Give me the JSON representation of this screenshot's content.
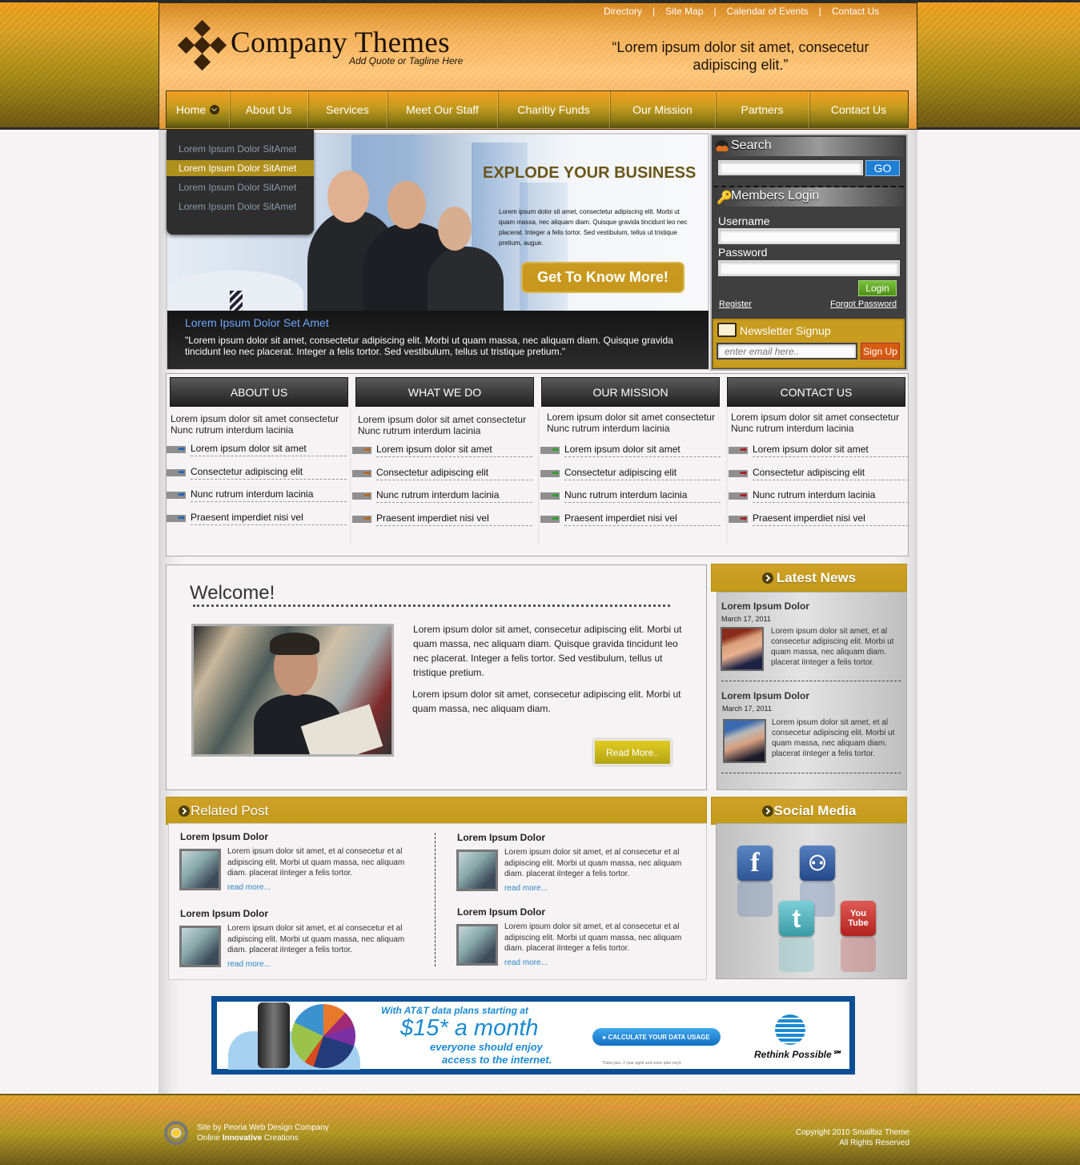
{
  "header": {
    "logo_text": "Company Themes",
    "tagline": "Add Quote or Tagline Here",
    "quote": "“Lorem ipsum dolor sit amet, consecetur adipiscing elit.”",
    "top_links": [
      "Directory",
      "Site Map",
      "Calendar of Events",
      "Contact Us"
    ],
    "top_link_separator": "|"
  },
  "nav": {
    "items": [
      {
        "label": "Home",
        "has_dropdown": true
      },
      {
        "label": "About Us"
      },
      {
        "label": "Services"
      },
      {
        "label": "Meet Our Staff"
      },
      {
        "label": "Charitiy Funds"
      },
      {
        "label": "Our Mission"
      },
      {
        "label": "Partners"
      },
      {
        "label": "Contact Us"
      }
    ],
    "dropdown": [
      {
        "label": "Lorem Ipsum Dolor SitAmet",
        "active": false
      },
      {
        "label": "Lorem Ipsum Dolor SitAmet",
        "active": true
      },
      {
        "label": "Lorem Ipsum Dolor SitAmet",
        "active": false
      },
      {
        "label": "Lorem Ipsum Dolor SitAmet",
        "active": false
      }
    ]
  },
  "hero": {
    "title": "EXPLODE YOUR BUSINESS",
    "body": "Lorem ipsum dolor sit amet, consectetur adipiscing elit. Morbi ut quam massa, nec aliquam diam. Quisque gravida tincidunt leo nec placerat. Integer a felis tortor. Sed vestibulum, tellus ut tristique pretium, augue.",
    "cta": "Get To Know More!",
    "caption_title": "Lorem Ipsum Dolor Set Amet",
    "caption_body": "\"Lorem ipsum dolor sit amet, consectetur adipiscing elit. Morbi ut quam massa, nec aliquam diam. Quisque gravida tincidunt leo nec placerat. Integer a felis tortor. Sed vestibulum, tellus ut tristique pretium.\""
  },
  "sidebar": {
    "search": {
      "title": "Search",
      "value": "",
      "go_label": "GO"
    },
    "login": {
      "title": "Members Login",
      "username_label": "Username",
      "username_value": "",
      "password_label": "Password",
      "password_value": "",
      "login_label": "Login",
      "register_label": "Register",
      "forgot_label": "Forgot Password"
    },
    "newsletter": {
      "title": "Newsletter Signup",
      "placeholder": "enter email here..",
      "signup_label": "Sign Up"
    }
  },
  "columns": [
    {
      "title": "ABOUT US",
      "intro": "Lorem ipsum dolor sit amet consectetur Nunc rutrum interdum lacinia",
      "arrow_color": "#1e63b8",
      "items": [
        "Lorem ipsum dolor sit amet",
        "Consectetur adipiscing elit",
        "Nunc rutrum interdum lacinia",
        "Praesent imperdiet nisi vel"
      ]
    },
    {
      "title": "WHAT WE DO",
      "intro": "Lorem ipsum dolor sit amet consectetur Nunc rutrum interdum lacinia",
      "arrow_color": "#b8661a",
      "items": [
        "Lorem ipsum dolor sit amet",
        "Consectetur adipiscing elit",
        "Nunc rutrum interdum lacinia",
        "Praesent imperdiet nisi vel"
      ]
    },
    {
      "title": "OUR MISSION",
      "intro": "Lorem ipsum dolor sit amet consectetur Nunc rutrum interdum lacinia",
      "arrow_color": "#2aa22a",
      "items": [
        "Lorem ipsum dolor sit amet",
        "Consectetur adipiscing elit",
        "Nunc rutrum interdum lacinia",
        "Praesent imperdiet nisi vel"
      ]
    },
    {
      "title": "CONTACT US",
      "intro": "Lorem ipsum dolor sit amet consectetur Nunc rutrum interdum lacinia",
      "arrow_color": "#b01818",
      "items": [
        "Lorem ipsum dolor sit amet",
        "Consectetur adipiscing elit",
        "Nunc rutrum interdum lacinia",
        "Praesent imperdiet nisi vel"
      ]
    }
  ],
  "welcome": {
    "title": "Welcome!",
    "paragraphs": [
      "Lorem ipsum dolor sit amet, consecetur adipiscing elit. Morbi ut quam massa, nec aliquam diam. Quisque gravida tincidunt leo nec placerat. Integer a felis tortor. Sed vestibulum, tellus ut tristique pretium.",
      "Lorem ipsum dolor sit amet, consecetur adipiscing elit. Morbi ut quam massa, nec aliquam diam."
    ],
    "read_more": "Read More.."
  },
  "latest_news": {
    "title": "Latest News",
    "items": [
      {
        "title": "Lorem Ipsum Dolor",
        "date": "March 17, 2011",
        "text": "Lorem ipsum dolor sit amet, et al consecetur adipiscing elit. Morbi ut quam massa, nec aliquam diam. placerat iInteger a felis tortor."
      },
      {
        "title": "Lorem Ipsum Dolor",
        "date": "March 17, 2011",
        "text": "Lorem ipsum dolor sit amet, et al consecetur adipiscing elit. Morbi ut quam massa, nec aliquam diam. placerat iInteger a felis tortor."
      }
    ]
  },
  "related": {
    "title": "Related Post",
    "posts": [
      {
        "title": "Lorem Ipsum Dolor",
        "text": "Lorem ipsum dolor sit amet, et al consecetur et al adipiscing elit. Morbi ut quam massa, nec aliquam diam. placerat iInteger a felis tortor.",
        "more": "read more..."
      },
      {
        "title": "Lorem Ipsum Dolor",
        "text": "Lorem ipsum dolor sit amet, et al consecetur et al adipiscing elit. Morbi ut quam massa, nec aliquam diam. placerat iInteger a felis tortor.",
        "more": "read more..."
      },
      {
        "title": "Lorem Ipsum Dolor",
        "text": "Lorem ipsum dolor sit amet, et al consecetur et al adipiscing elit. Morbi ut quam massa, nec aliquam diam. placerat iInteger a felis tortor.",
        "more": "read more..."
      },
      {
        "title": "Lorem Ipsum Dolor",
        "text": "Lorem ipsum dolor sit amet, et al consecetur et al adipiscing elit. Morbi ut quam massa, nec aliquam diam. placerat iInteger a felis tortor.",
        "more": "read more..."
      }
    ]
  },
  "social": {
    "title": "Social Media",
    "icons": [
      {
        "name": "facebook",
        "glyph": "f",
        "color": "#3b66a8"
      },
      {
        "name": "myspace",
        "glyph": "⚇",
        "color": "#2f5ea3"
      },
      {
        "name": "twitter",
        "glyph": "t",
        "color": "#4fb3bd"
      },
      {
        "name": "youtube",
        "glyph": "You Tube",
        "color": "#c9302c"
      }
    ]
  },
  "ad": {
    "line1": "With AT&T data plans starting at",
    "line2": "$15* a month",
    "line3": "everyone should enjoy",
    "line4": "access to the internet.",
    "button": "▸ CALCULATE YOUR DATA USAGE",
    "fine_print": "*Data plan, 2 year agmt and voice plan req'd",
    "slogan": "Rethink Possible℠"
  },
  "footer": {
    "site_by": "Site by Peoria Web Design Company",
    "line2_pre": "Online ",
    "line2_bold": "Innovative",
    "line2_post": " Creations",
    "copyright": "Copyright 2010 Smallbiz Theme",
    "rights": "All Rights Reserved"
  },
  "colors": {
    "gold": "#c79c1f",
    "nav_top": "#f3a023",
    "dark_panel": "#3f3f40",
    "link_blue": "#2f86c4",
    "caption_blue": "#6fa6ff"
  }
}
